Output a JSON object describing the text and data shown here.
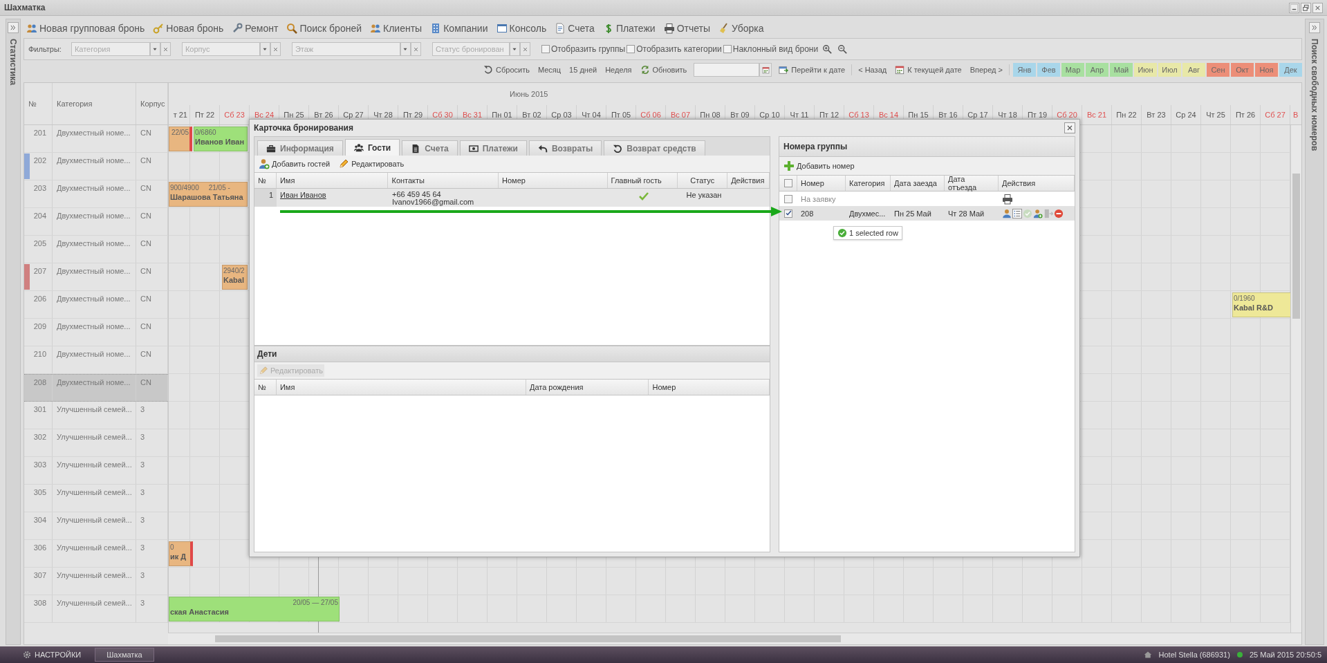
{
  "window": {
    "title": "Шахматка"
  },
  "side_panels": {
    "left": "Статистика",
    "right": "Поиск свободных номеров"
  },
  "menu": [
    {
      "label": "Новая групповая бронь"
    },
    {
      "label": "Новая бронь"
    },
    {
      "label": "Ремонт"
    },
    {
      "label": "Поиск броней"
    },
    {
      "label": "Клиенты"
    },
    {
      "label": "Компании"
    },
    {
      "label": "Консоль"
    },
    {
      "label": "Счета"
    },
    {
      "label": "Платежи"
    },
    {
      "label": "Отчеты"
    },
    {
      "label": "Уборка"
    }
  ],
  "filters": {
    "label": "Фильтры:",
    "combos": [
      {
        "placeholder": "Категория"
      },
      {
        "placeholder": "Корпус"
      },
      {
        "placeholder": "Этаж"
      },
      {
        "placeholder": "Статус бронирован"
      }
    ],
    "checkboxes": [
      {
        "label": "Отобразить группы",
        "checked": false
      },
      {
        "label": "Отобразить категории",
        "checked": false
      },
      {
        "label": "Наклонный вид брони",
        "checked": false
      }
    ]
  },
  "view_buttons": [
    {
      "label": "Сбросить"
    },
    {
      "label": "Месяц"
    },
    {
      "label": "15 дней"
    },
    {
      "label": "Неделя"
    },
    {
      "label": "Обновить"
    }
  ],
  "date_buttons": [
    {
      "label": "Перейти к дате"
    },
    {
      "label": "< Назад"
    },
    {
      "label": "К текущей дате"
    },
    {
      "label": "Вперед >"
    }
  ],
  "months": [
    {
      "label": "Янв",
      "color": "#a9d6ea"
    },
    {
      "label": "Фев",
      "color": "#a9d6ea"
    },
    {
      "label": "Мар",
      "color": "#a8e0a0"
    },
    {
      "label": "Апр",
      "color": "#a8e0a0"
    },
    {
      "label": "Май",
      "color": "#a8e0a0"
    },
    {
      "label": "Июн",
      "color": "#e8e8a8"
    },
    {
      "label": "Июл",
      "color": "#e8e8a8"
    },
    {
      "label": "Авг",
      "color": "#e8e8a8"
    },
    {
      "label": "Сен",
      "color": "#ec8e78"
    },
    {
      "label": "Окт",
      "color": "#ec8e78"
    },
    {
      "label": "Ноя",
      "color": "#ec8e78"
    },
    {
      "label": "Дек",
      "color": "#a9d6ea"
    }
  ],
  "grid": {
    "columns": [
      "№",
      "Категория",
      "Корпус"
    ],
    "month": "Июнь 2015",
    "days": [
      {
        "label": "т 21",
        "weekend": false
      },
      {
        "label": "Пт 22",
        "weekend": false
      },
      {
        "label": "Сб 23",
        "weekend": true
      },
      {
        "label": "Вс 24",
        "weekend": true
      },
      {
        "label": "Пн 25",
        "weekend": false
      },
      {
        "label": "Вт 26",
        "weekend": false
      },
      {
        "label": "Ср 27",
        "weekend": false
      },
      {
        "label": "Чт 28",
        "weekend": false
      },
      {
        "label": "Пт 29",
        "weekend": false
      },
      {
        "label": "Сб 30",
        "weekend": true
      },
      {
        "label": "Вс 31",
        "weekend": true
      },
      {
        "label": "Пн 01",
        "weekend": false
      },
      {
        "label": "Вт 02",
        "weekend": false
      },
      {
        "label": "Ср 03",
        "weekend": false
      },
      {
        "label": "Чт 04",
        "weekend": false
      },
      {
        "label": "Пт 05",
        "weekend": false
      },
      {
        "label": "Сб 06",
        "weekend": true
      },
      {
        "label": "Вс 07",
        "weekend": true
      },
      {
        "label": "Пн 08",
        "weekend": false
      },
      {
        "label": "Вт 09",
        "weekend": false
      },
      {
        "label": "Ср 10",
        "weekend": false
      },
      {
        "label": "Чт 11",
        "weekend": false
      },
      {
        "label": "Пт 12",
        "weekend": false
      },
      {
        "label": "Сб 13",
        "weekend": true
      },
      {
        "label": "Вс 14",
        "weekend": true
      },
      {
        "label": "Пн 15",
        "weekend": false
      },
      {
        "label": "Вт 16",
        "weekend": false
      },
      {
        "label": "Ср 17",
        "weekend": false
      },
      {
        "label": "Чт 18",
        "weekend": false
      },
      {
        "label": "Пт 19",
        "weekend": false
      },
      {
        "label": "Сб 20",
        "weekend": true
      },
      {
        "label": "Вс 21",
        "weekend": true
      },
      {
        "label": "Пн 22",
        "weekend": false
      },
      {
        "label": "Вт 23",
        "weekend": false
      },
      {
        "label": "Ср 24",
        "weekend": false
      },
      {
        "label": "Чт 25",
        "weekend": false
      },
      {
        "label": "Пт 26",
        "weekend": false
      },
      {
        "label": "Сб 27",
        "weekend": true
      },
      {
        "label": "В",
        "weekend": true
      }
    ],
    "rows": [
      {
        "number": "201",
        "category": "Двухместный номе...",
        "building": "CN",
        "selected": false,
        "bookings": [
          {
            "color": "#e8b680",
            "dates": "22/05",
            "flag": true
          },
          {
            "color": "#9ee07a",
            "amount": "0/6860",
            "guest": "Иванов Иван"
          }
        ]
      },
      {
        "number": "202",
        "category": "Двухместный номе...",
        "building": "CN",
        "selected": false,
        "color": "#8fa9d8"
      },
      {
        "number": "203",
        "category": "Двухместный номе...",
        "building": "CN",
        "selected": false,
        "bookings": [
          {
            "color": "#e8b680",
            "amount": "900/4900",
            "dates": "21/05 -",
            "guest": "Шарашова Татьяна"
          }
        ]
      },
      {
        "number": "204",
        "category": "Двухместный номе...",
        "building": "CN",
        "selected": false
      },
      {
        "number": "205",
        "category": "Двухместный номе...",
        "building": "CN",
        "selected": false
      },
      {
        "number": "207",
        "category": "Двухместный номе...",
        "building": "CN",
        "selected": false,
        "color": "#d08080",
        "bookings": [
          {
            "color": "#e8b680",
            "amount": "2940/2",
            "guest": "Kabal"
          }
        ]
      },
      {
        "number": "206",
        "category": "Двухместный номе...",
        "building": "CN",
        "selected": false,
        "bookings": [
          {
            "color": "#eee898",
            "amount": "0/1960",
            "guest": "Kabal R&D"
          }
        ]
      },
      {
        "number": "209",
        "category": "Двухместный номе...",
        "building": "CN",
        "selected": false
      },
      {
        "number": "210",
        "category": "Двухместный номе...",
        "building": "CN",
        "selected": false
      },
      {
        "number": "208",
        "category": "Двухместный номе...",
        "building": "CN",
        "selected": true
      },
      {
        "number": "301",
        "category": "Улучшенный семей...",
        "building": "3",
        "selected": false
      },
      {
        "number": "302",
        "category": "Улучшенный семей...",
        "building": "3",
        "selected": false
      },
      {
        "number": "303",
        "category": "Улучшенный семей...",
        "building": "3",
        "selected": false
      },
      {
        "number": "305",
        "category": "Улучшенный семей...",
        "building": "3",
        "selected": false
      },
      {
        "number": "304",
        "category": "Улучшенный семей...",
        "building": "3",
        "selected": false
      },
      {
        "number": "306",
        "category": "Улучшенный семей...",
        "building": "3",
        "selected": false,
        "bookings": [
          {
            "color": "#e8b680",
            "amount": "0",
            "guest": "ик Д",
            "flag": true
          }
        ]
      },
      {
        "number": "307",
        "category": "Улучшенный семей...",
        "building": "3",
        "selected": false
      },
      {
        "number": "308",
        "category": "Улучшенный семей...",
        "building": "3",
        "selected": false,
        "bookings": [
          {
            "color": "#9ee07a",
            "dates": "20/05 — 27/05",
            "guest": "ская Анастасия",
            "flag": false
          }
        ]
      }
    ]
  },
  "dialog": {
    "title": "Карточка бронирования",
    "tabs": [
      {
        "label": "Информация",
        "selected": false
      },
      {
        "label": "Гости",
        "selected": true
      },
      {
        "label": "Счета",
        "selected": false
      },
      {
        "label": "Платежи",
        "selected": false
      },
      {
        "label": "Возвраты",
        "selected": false
      },
      {
        "label": "Возврат средств",
        "selected": false
      }
    ],
    "guests": {
      "toolbar": [
        {
          "label": "Добавить гостей",
          "disabled": false
        },
        {
          "label": "Редактировать",
          "disabled": false
        }
      ],
      "columns": [
        "№",
        "Имя",
        "Контакты",
        "Номер",
        "Главный гость",
        "Статус",
        "Действия"
      ],
      "rows": [
        {
          "index": "1",
          "name": "Иван Иванов",
          "phone": "+66 459 45 64",
          "email": "Ivanov1966@gmail.com",
          "main_guest": true,
          "status": "Не указан"
        }
      ]
    },
    "children": {
      "title": "Дети",
      "toolbar": [
        {
          "label": "Редактировать",
          "disabled": true
        }
      ],
      "columns": [
        "№",
        "Имя",
        "Дата рождения",
        "Номер"
      ]
    },
    "group_rooms": {
      "title": "Номера группы",
      "add_button": "Добавить номер",
      "select_all": {
        "checked": false
      },
      "columns": [
        "Номер",
        "Категория",
        "Дата заезда",
        "Дата отъезда",
        "Действия"
      ],
      "rows": [
        {
          "kind": "request",
          "number": "На заявку",
          "checked": false,
          "selected": false
        },
        {
          "kind": "room",
          "number": "208",
          "category": "Двухмес...",
          "checkin": "Пн 25 Май",
          "checkout": "Чт 28 Май",
          "checked": true,
          "selected": true
        }
      ],
      "tooltip": "1 selected row"
    }
  },
  "taskbar": {
    "start": "НАСТРОЙКИ",
    "windows": [
      {
        "label": "Шахматка",
        "selected": true
      }
    ],
    "hotel": "Hotel Stella (686931)",
    "clock": "25 Май 2015 20:50:5"
  }
}
